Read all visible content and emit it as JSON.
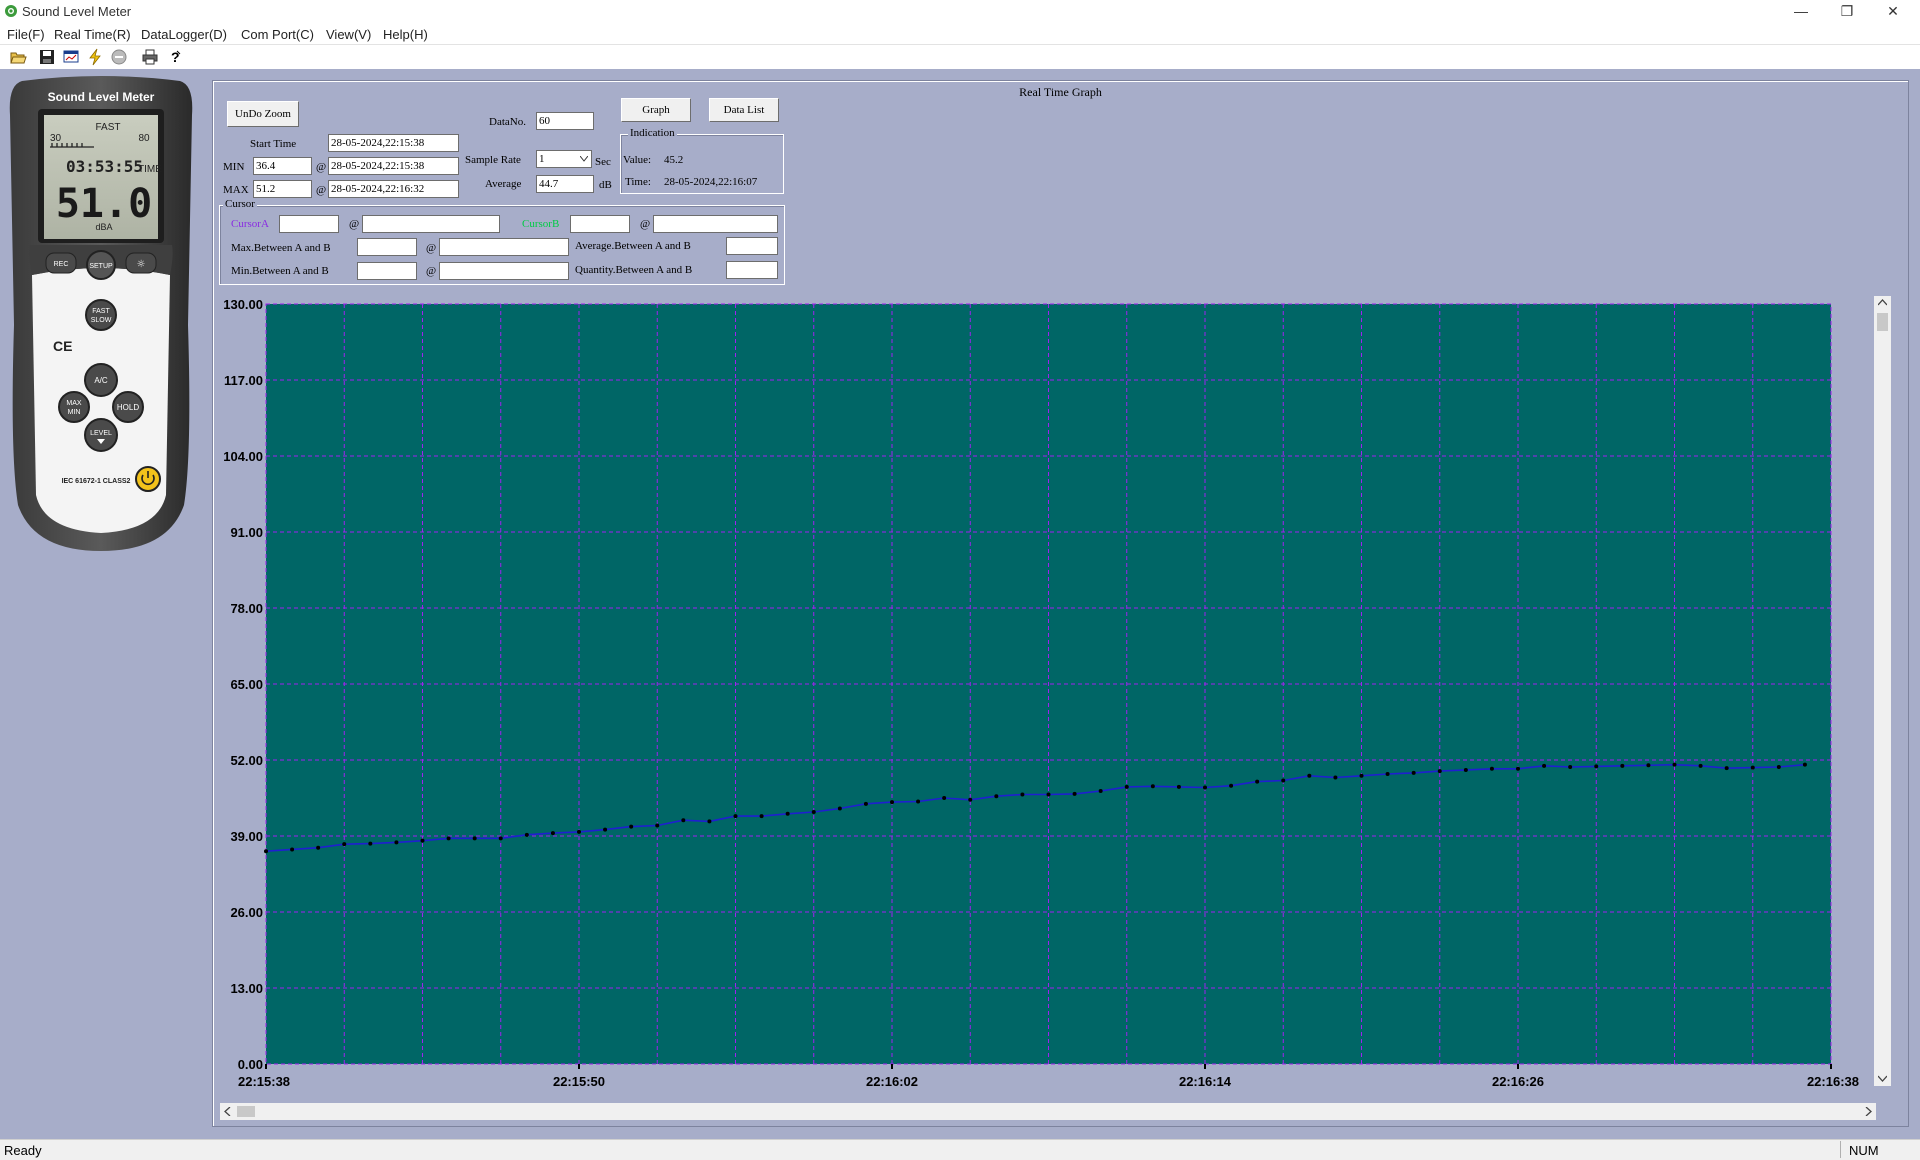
{
  "window": {
    "title": "Sound Level Meter",
    "minimize_glyph": "—",
    "restore_glyph": "❐",
    "close_glyph": "✕"
  },
  "menu": [
    "File(F)",
    "Real Time(R)",
    "DataLogger(D)",
    "Com Port(C)",
    "View(V)",
    "Help(H)"
  ],
  "toolbar": {
    "icons": [
      "open-folder-icon",
      "save-icon",
      "monitor-icon",
      "connect-lightning-icon",
      "stop-icon",
      "print-icon",
      "help-icon"
    ]
  },
  "meter": {
    "brand": "Sound Level Meter",
    "mode": "FAST",
    "range_low": "30",
    "range_high": "80",
    "clock": "03:53:55",
    "time_label": "TIME",
    "reading": "51.0",
    "unit": "dBA",
    "buttons": {
      "rec": "REC",
      "setup": "SETUP",
      "light": "☼",
      "fast_slow_1": "FAST",
      "fast_slow_2": "SLOW",
      "ac": "A/C",
      "max_min_1": "MAX",
      "max_min_2": "MIN",
      "hold": "HOLD",
      "level": "LEVEL"
    },
    "ce": "CE",
    "standard": "IEC 61672-1 CLASS2"
  },
  "panel": {
    "title": "Real Time Graph",
    "undo_zoom": "UnDo Zoom",
    "datano_label": "DataNo.",
    "datano_value": "60",
    "graph_button": "Graph",
    "datalist_button": "Data List",
    "start_time_label": "Start Time",
    "start_time": "28-05-2024,22:15:38",
    "min_label": "MIN",
    "min_value": "36.4",
    "min_time": "28-05-2024,22:15:38",
    "max_label": "MAX",
    "max_value": "51.2",
    "max_time": "28-05-2024,22:16:32",
    "at": "@",
    "sample_rate_label": "Sample Rate",
    "sample_rate_value": "1",
    "sec": "Sec",
    "average_label": "Average",
    "average_value": "44.7",
    "db": "dB",
    "indication_label": "Indication",
    "value_label": "Value:",
    "value": "45.2",
    "time_label": "Time:",
    "time_value": "28-05-2024,22:16:07",
    "cursor_label": "Cursor",
    "cursor_a": "CursorA",
    "cursor_b": "CursorB",
    "max_ab": "Max.Between A and B",
    "min_ab": "Min.Between A and B",
    "avg_ab": "Average.Between A and B",
    "qty_ab": "Quantity.Between A and B"
  },
  "colors": {
    "plot_bg": "#006666",
    "grid": "#a020f0",
    "line": "#1f1fd0",
    "point": "#000000",
    "cursor_a": "#8a2be2",
    "cursor_b": "#00cc44"
  },
  "chart_data": {
    "type": "line",
    "title": "Real Time Graph",
    "xlabel": "",
    "ylabel": "",
    "ylim": [
      0,
      130
    ],
    "y_ticks": [
      "130.00",
      "117.00",
      "104.00",
      "91.00",
      "78.00",
      "65.00",
      "52.00",
      "39.00",
      "26.00",
      "13.00",
      "0.00"
    ],
    "x_ticks": [
      "22:15:38",
      "22:15:50",
      "22:16:02",
      "22:16:14",
      "22:16:26",
      "22:16:38"
    ],
    "grid": true,
    "x_unit": "seconds after 22:15:38",
    "x": [
      0,
      1,
      2,
      3,
      4,
      5,
      6,
      7,
      8,
      9,
      10,
      11,
      12,
      13,
      14,
      15,
      16,
      17,
      18,
      19,
      20,
      21,
      22,
      23,
      24,
      25,
      26,
      27,
      28,
      29,
      30,
      31,
      32,
      33,
      34,
      35,
      36,
      37,
      38,
      39,
      40,
      41,
      42,
      43,
      44,
      45,
      46,
      47,
      48,
      49,
      50,
      51,
      52,
      53,
      54,
      55,
      56,
      57,
      58,
      59
    ],
    "series": [
      {
        "values": [
          36.4,
          36.7,
          37.0,
          37.6,
          37.7,
          37.9,
          38.2,
          38.6,
          38.6,
          38.6,
          39.2,
          39.5,
          39.7,
          40.1,
          40.6,
          40.8,
          41.7,
          41.5,
          42.4,
          42.4,
          42.8,
          43.1,
          43.7,
          44.5,
          44.8,
          44.9,
          45.5,
          45.2,
          45.8,
          46.1,
          46.1,
          46.2,
          46.7,
          47.4,
          47.5,
          47.4,
          47.3,
          47.6,
          48.3,
          48.5,
          49.3,
          49.0,
          49.3,
          49.6,
          49.8,
          50.1,
          50.3,
          50.5,
          50.5,
          51.0,
          50.8,
          50.9,
          51.0,
          51.1,
          51.2,
          51.0,
          50.6,
          50.7,
          50.8,
          51.2
        ]
      }
    ]
  },
  "status": {
    "left": "Ready",
    "right": "NUM"
  }
}
